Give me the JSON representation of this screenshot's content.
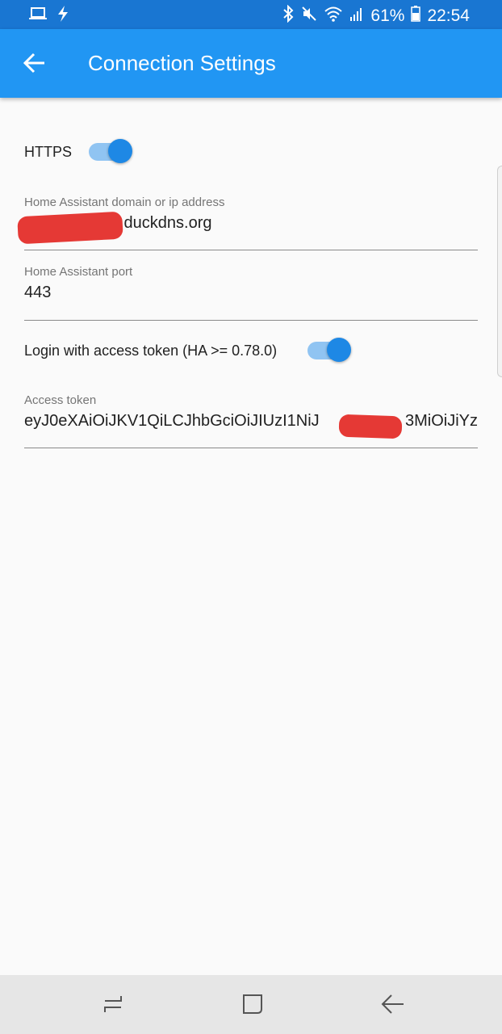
{
  "status_bar": {
    "battery": "61%",
    "time": "22:54",
    "icons": [
      "laptop-icon",
      "flash-icon",
      "bluetooth-icon",
      "mute-icon",
      "wifi-icon",
      "signal-icon",
      "battery-icon"
    ]
  },
  "app_bar": {
    "title": "Connection Settings",
    "back_icon": "arrow-back-icon",
    "color": "#2196f3"
  },
  "settings": {
    "https": {
      "label": "HTTPS",
      "enabled": true
    },
    "domain": {
      "label": "Home Assistant domain or ip address",
      "value": ".duckdns.org"
    },
    "port": {
      "label": "Home Assistant port",
      "value": "443"
    },
    "access_token_toggle": {
      "label": "Login with access token (HA >= 0.78.0)",
      "enabled": true
    },
    "access_token": {
      "label": "Access token",
      "value_start": "eyJ0eXAiOiJKV1QiLCJhbGciOiJIUzI1NiJ",
      "value_end": "3MiOiJiYz"
    }
  },
  "nav_bar": {
    "buttons": [
      "recent-apps-icon",
      "home-icon",
      "back-icon"
    ]
  },
  "colors": {
    "accent": "#1e88e5",
    "track": "#90c4f2",
    "redaction": "#e53935"
  }
}
